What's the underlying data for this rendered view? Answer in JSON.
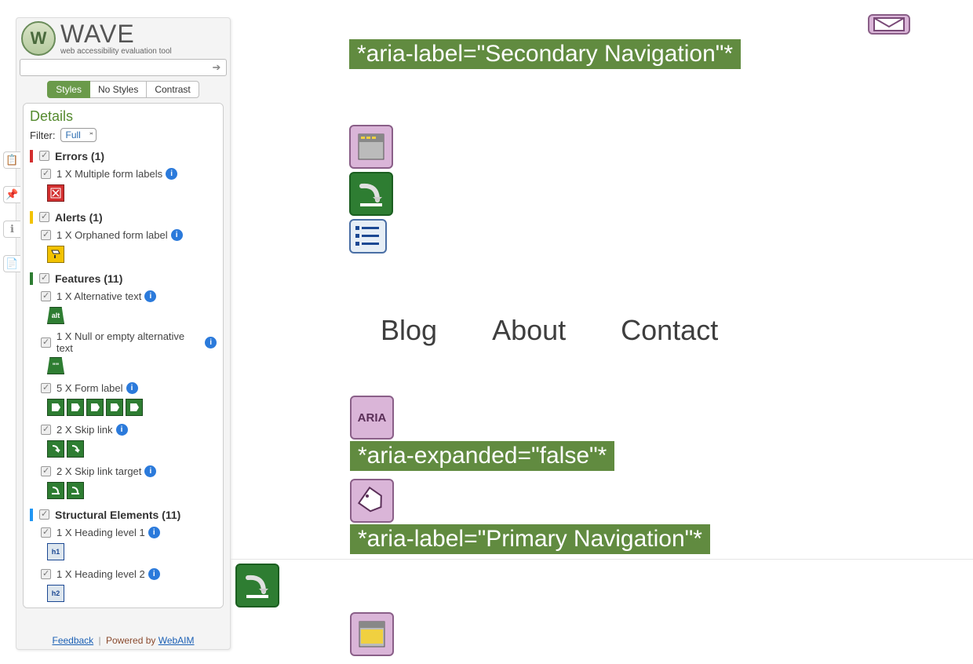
{
  "logo": {
    "title": "WAVE",
    "subtitle": "web accessibility evaluation tool",
    "mark": "W"
  },
  "url_input": {
    "value": ""
  },
  "tabs": {
    "styles": "Styles",
    "no_styles": "No Styles",
    "contrast": "Contrast"
  },
  "details": {
    "title": "Details",
    "filter_label": "Filter:",
    "filter_value": "Full"
  },
  "cats": {
    "errors": {
      "title": "Errors (1)",
      "i0": "1 X Multiple form labels"
    },
    "alerts": {
      "title": "Alerts (1)",
      "i0": "1 X Orphaned form label"
    },
    "features": {
      "title": "Features (11)",
      "i0": "1 X Alternative text",
      "i1": "1 X Null or empty alternative text",
      "i2": "5 X Form label",
      "i3": "2 X Skip link",
      "i4": "2 X Skip link target"
    },
    "structural": {
      "title": "Structural Elements (11)",
      "i0": "1 X Heading level 1",
      "i1": "1 X Heading level 2"
    }
  },
  "icons": {
    "alt": "alt",
    "aria": "ARIA",
    "h1": "h1",
    "h2": "h2",
    "info": "i",
    "null_alt": "\"\""
  },
  "footer": {
    "feedback": "Feedback",
    "powered": "Powered by",
    "webaim": "WebAIM"
  },
  "main": {
    "aria_secondary": "*aria-label=\"Secondary Navigation\"*",
    "aria_expanded": "*aria-expanded=\"false\"*",
    "aria_primary": "*aria-label=\"Primary Navigation\"*",
    "nav": {
      "blog": "Blog",
      "about": "About",
      "contact": "Contact"
    }
  }
}
